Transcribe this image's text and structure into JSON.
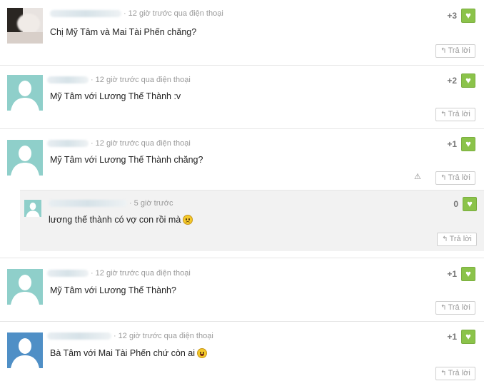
{
  "action_label": "Trả lời",
  "comments": [
    {
      "meta": "12 giờ trước qua điện thoại",
      "text": "Chị Mỹ Tâm và Mai Tài Phến chăng?",
      "score": "+3"
    },
    {
      "meta": "12 giờ trước qua điện thoại",
      "text": "Mỹ Tâm với Lương Thế Thành :v",
      "score": "+2"
    },
    {
      "meta": "12 giờ trước qua điện thoại",
      "text": "Mỹ Tâm với Lương Thế Thành chăng?",
      "score": "+1",
      "reply": {
        "meta": "5 giờ trước",
        "text": "lương thế thành có vợ con rồi mà",
        "score": "0"
      }
    },
    {
      "meta": "12 giờ trước qua điện thoại",
      "text": "Mỹ Tâm với Lương Thế Thành?",
      "score": "+1"
    },
    {
      "meta": "12 giờ trước qua điện thoại",
      "text": "Bà Tâm với Mai Tài Phến chứ còn ai",
      "score": "+1"
    }
  ],
  "colors": {
    "like": "#8bc34a",
    "avatar_teal": "#8fcfca",
    "avatar_blue": "#4f8fc6",
    "reply_bg": "#f2f2f2"
  }
}
